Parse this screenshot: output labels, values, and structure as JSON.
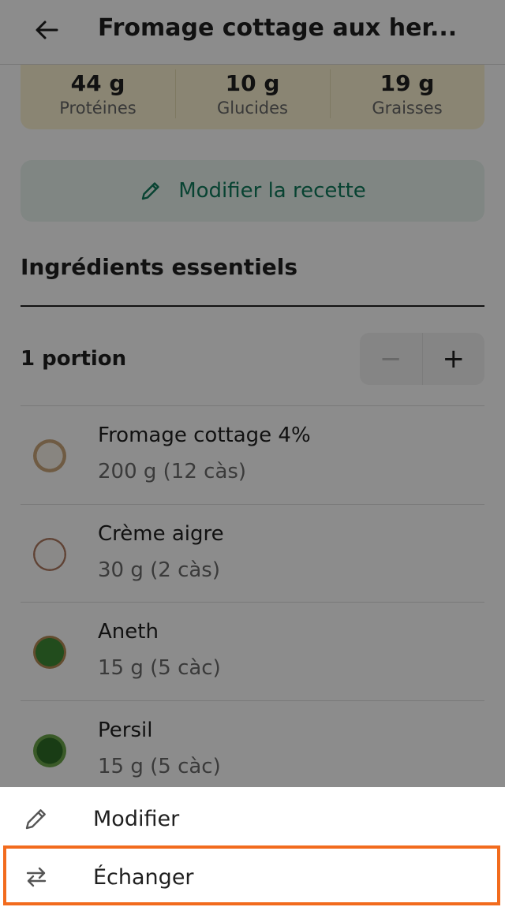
{
  "header": {
    "title": "Fromage cottage aux her...",
    "back_icon": "arrow-left-icon"
  },
  "macros": [
    {
      "value": "44 g",
      "label": "Protéines"
    },
    {
      "value": "10 g",
      "label": "Glucides"
    },
    {
      "value": "19 g",
      "label": "Graisses"
    }
  ],
  "edit_recipe": {
    "label": "Modifier la recette",
    "icon": "pencil-icon"
  },
  "section": {
    "title": "Ingrédients essentiels"
  },
  "portion": {
    "label": "1 portion",
    "minus": "−",
    "plus": "+"
  },
  "ingredients": [
    {
      "name": "Fromage cottage 4%",
      "qty": "200 g (12 càs)"
    },
    {
      "name": "Crème aigre",
      "qty": "30 g (2 càs)"
    },
    {
      "name": "Aneth",
      "qty": "15 g (5 càc)"
    },
    {
      "name": "Persil",
      "qty": "15 g (5 càc)"
    }
  ],
  "sheet": {
    "edit_label": "Modifier",
    "swap_label": "Échanger"
  },
  "colors": {
    "accent": "#0f7a5c",
    "highlight": "#f26b1d",
    "macro_bg": "#fbf3d2"
  }
}
